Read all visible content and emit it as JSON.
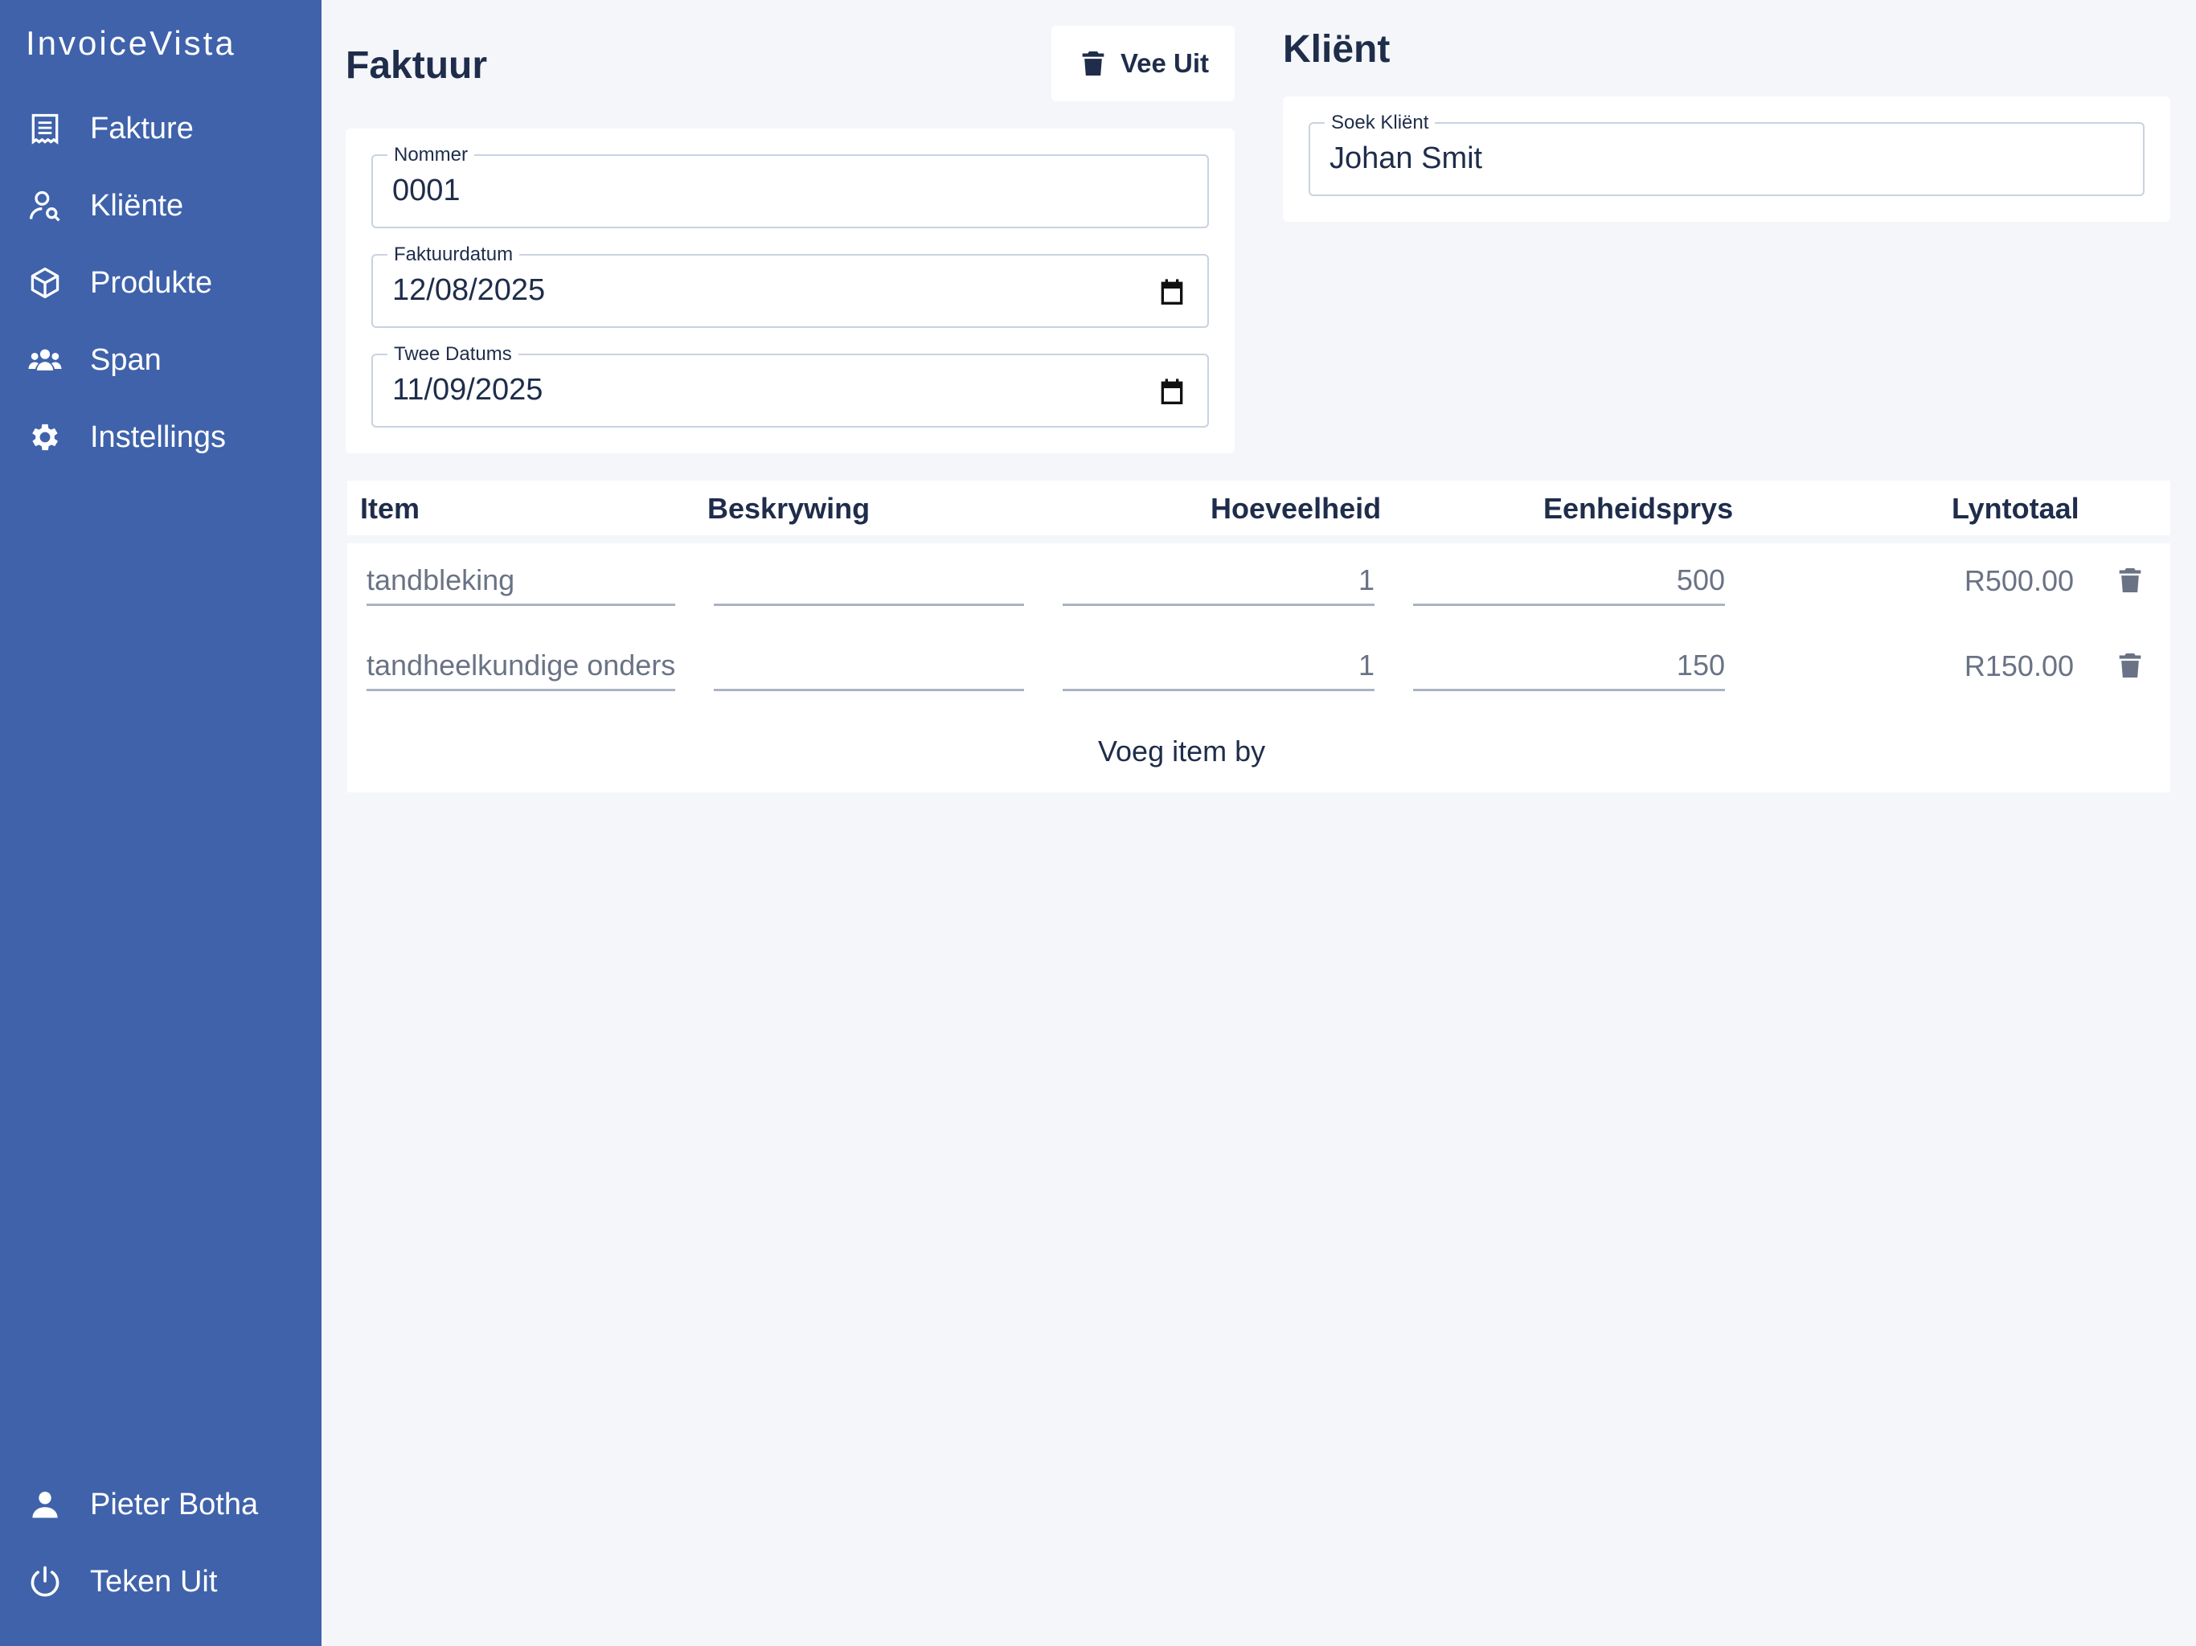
{
  "app": {
    "brand": "InvoiceVista"
  },
  "sidebar": {
    "items": [
      {
        "label": "Fakture",
        "icon": "receipt-icon"
      },
      {
        "label": "Kliënte",
        "icon": "user-search-icon"
      },
      {
        "label": "Produkte",
        "icon": "cube-icon"
      },
      {
        "label": "Span",
        "icon": "users-icon"
      },
      {
        "label": "Instellings",
        "icon": "gear-icon"
      }
    ],
    "user": {
      "label": "Pieter Botha",
      "icon": "person-icon"
    },
    "logout": {
      "label": "Teken Uit",
      "icon": "power-icon"
    }
  },
  "invoice": {
    "title": "Faktuur",
    "delete_label": "Vee Uit",
    "number": {
      "label": "Nommer",
      "value": "0001"
    },
    "invoice_date": {
      "label": "Faktuurdatum",
      "value": "12/08/2025"
    },
    "due_date": {
      "label": "Twee Datums",
      "value": "11/09/2025"
    }
  },
  "client": {
    "title": "Kliënt",
    "search": {
      "label": "Soek Kliënt",
      "value": "Johan Smit"
    }
  },
  "table": {
    "headers": {
      "item": "Item",
      "description": "Beskrywing",
      "quantity": "Hoeveelheid",
      "unit_price": "Eenheidsprys",
      "line_total": "Lyntotaal"
    },
    "rows": [
      {
        "item": "tandbleking",
        "description": "",
        "quantity": "1",
        "unit_price": "500",
        "line_total": "R500.00"
      },
      {
        "item": "tandheelkundige onders",
        "description": "",
        "quantity": "1",
        "unit_price": "150",
        "line_total": "R150.00"
      }
    ],
    "add_item_label": "Voeg item by"
  },
  "colors": {
    "sidebar": "#3f62ab",
    "background": "#f4f6fa",
    "text": "#1f2d4b",
    "muted": "#6a7385"
  }
}
